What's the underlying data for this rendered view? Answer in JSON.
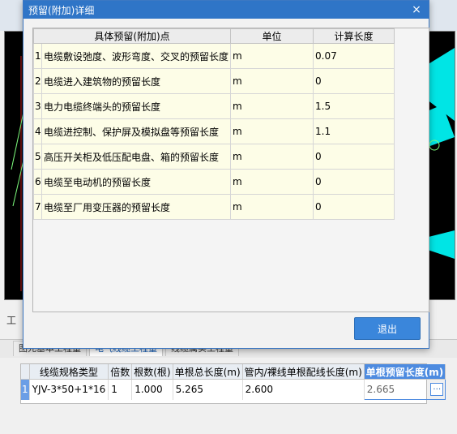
{
  "dialog": {
    "title": "预留(附加)详细",
    "close_glyph": "×",
    "exit_label": "退出",
    "table": {
      "headers": [
        "具体预留(附加)点",
        "单位",
        "计算长度"
      ],
      "rows": [
        {
          "idx": "1",
          "point": "电缆敷设弛度、波形弯度、交叉的预留长度",
          "unit": "m",
          "length": "0.07"
        },
        {
          "idx": "2",
          "point": "电缆进入建筑物的预留长度",
          "unit": "m",
          "length": "0"
        },
        {
          "idx": "3",
          "point": "电力电缆终端头的预留长度",
          "unit": "m",
          "length": "1.5"
        },
        {
          "idx": "4",
          "point": "电缆进控制、保护屏及模拟盘等预留长度",
          "unit": "m",
          "length": "1.1"
        },
        {
          "idx": "5",
          "point": "高压开关柜及低压配电盘、箱的预留长度",
          "unit": "m",
          "length": "0"
        },
        {
          "idx": "6",
          "point": "电缆至电动机的预留长度",
          "unit": "m",
          "length": "0"
        },
        {
          "idx": "7",
          "point": "电缆至厂用变压器的预留长度",
          "unit": "m",
          "length": "0"
        }
      ]
    }
  },
  "background": {
    "side_tab": "工",
    "tabs": [
      "图元基本工程量",
      "电气线缆工程量",
      "线缆属实工程量"
    ],
    "grid": {
      "headers": [
        "线缆规格类型",
        "倍数",
        "根数(根)",
        "单根总长度(m)",
        "管内/裸线单根配线长度(m)",
        "单根预留长度(m)"
      ],
      "row": {
        "num": "1",
        "type": "YJV-3*50+1*16",
        "multiple": "1",
        "count": "1.000",
        "total": "5.265",
        "conduit": "2.600",
        "reserve": "2.665",
        "btn": "…"
      }
    }
  },
  "colors": {
    "accent": "#2f75c7",
    "row_bg": "#fdfde7",
    "button": "#3a86db"
  }
}
